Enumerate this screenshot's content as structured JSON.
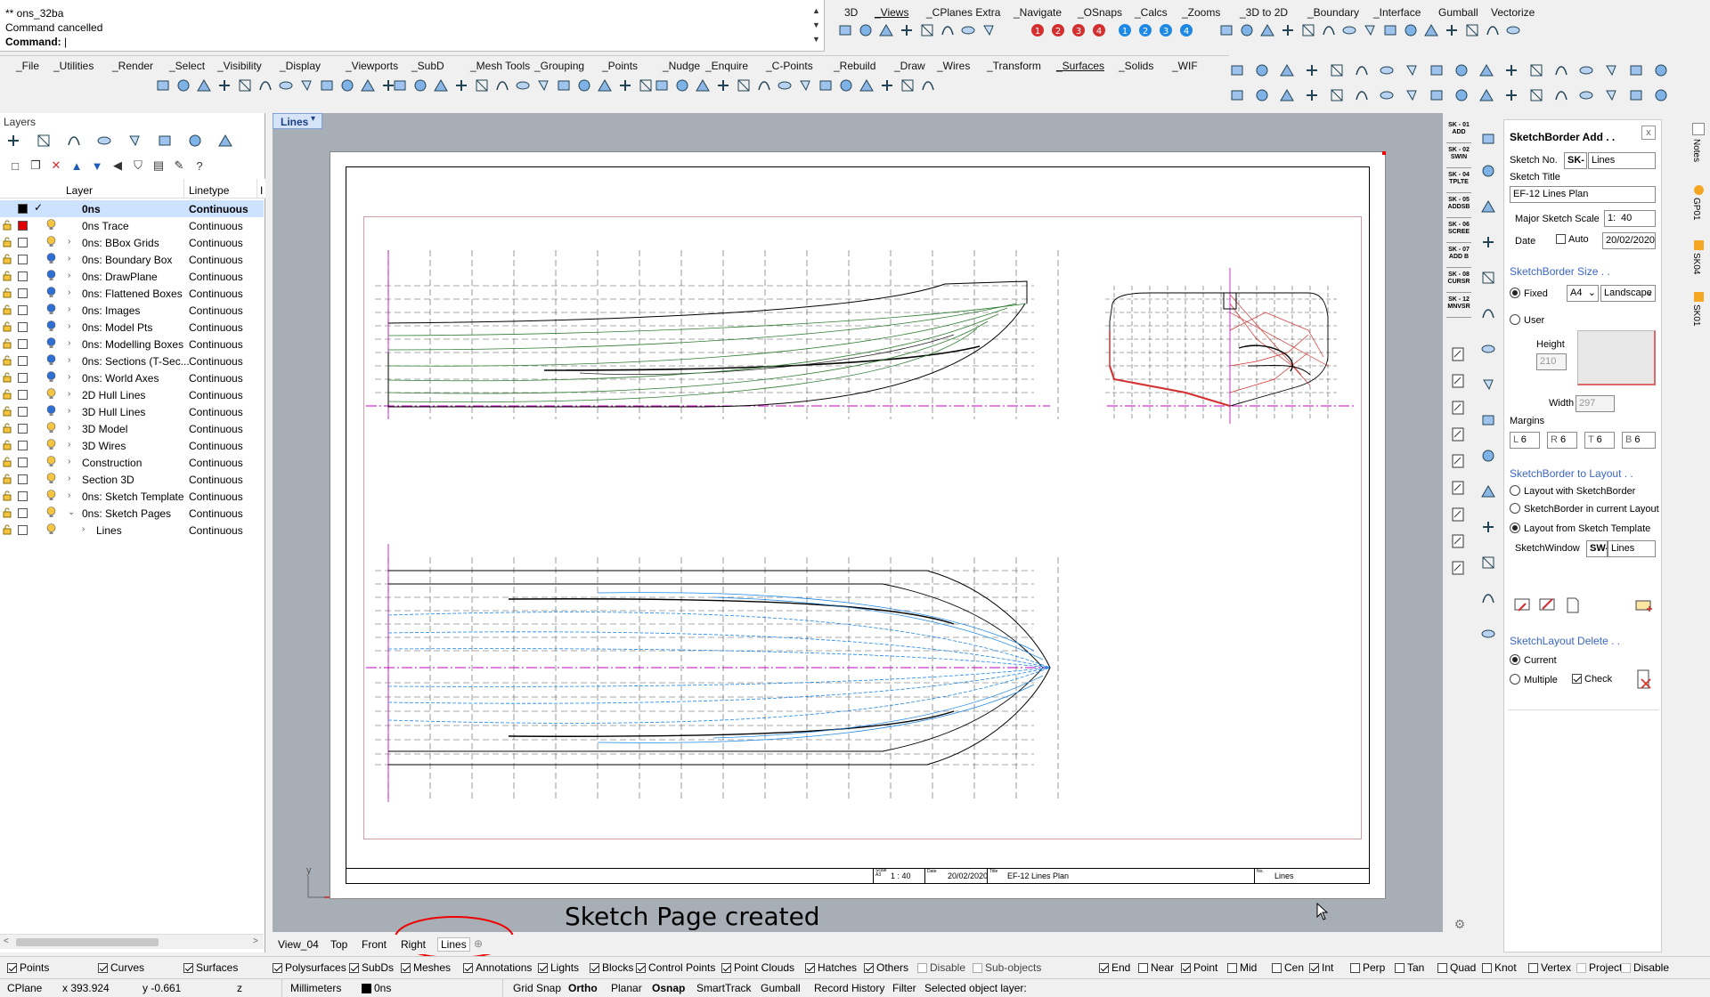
{
  "command": {
    "lines": [
      "** ons_32ba",
      "Command cancelled"
    ],
    "prompt": "Command:"
  },
  "toptabs": [
    "3D",
    "_Views",
    "_CPlanes Extra",
    "_Navigate",
    "_OSnaps",
    "_Calcs",
    "_Zooms",
    "_3D to 2D",
    "_Boundary",
    "_Interface",
    "Gumball",
    "Vectorize"
  ],
  "maintabs": [
    "_File",
    "_Utilities",
    "_Render",
    "_Select",
    "_Visibility",
    "_Display",
    "_Viewports",
    "_SubD",
    "_Mesh Tools",
    "_Grouping",
    "_Points",
    "_Nudge",
    "_Enquire",
    "_C-Points",
    "_Rebuild",
    "_Draw",
    "_Wires",
    "_Transform",
    "_Surfaces",
    "_Solids",
    "_WIF"
  ],
  "layers": {
    "title": "Layers",
    "col_layer": "Layer",
    "col_linetype": "Linetype",
    "col_extra": "I",
    "rows": [
      {
        "name": "0ns",
        "linetype": "Continuous",
        "current": true,
        "color": "#000000"
      },
      {
        "name": "0ns Trace",
        "linetype": "Continuous",
        "color": "#e00000"
      },
      {
        "name": "0ns: BBox Grids",
        "linetype": "Continuous",
        "expand": true
      },
      {
        "name": "0ns: Boundary Box",
        "linetype": "Continuous",
        "expand": true
      },
      {
        "name": "0ns: DrawPlane",
        "linetype": "Continuous",
        "expand": true
      },
      {
        "name": "0ns: Flattened Boxes",
        "linetype": "Continuous",
        "expand": true
      },
      {
        "name": "0ns: Images",
        "linetype": "Continuous",
        "expand": true
      },
      {
        "name": "0ns: Model Pts",
        "linetype": "Continuous",
        "expand": true
      },
      {
        "name": "0ns: Modelling Boxes",
        "linetype": "Continuous",
        "expand": true
      },
      {
        "name": "0ns: Sections (T-Sec...",
        "linetype": "Continuous",
        "expand": true
      },
      {
        "name": "0ns: World Axes",
        "linetype": "Continuous",
        "expand": true
      },
      {
        "name": "2D Hull Lines",
        "linetype": "Continuous",
        "expand": true
      },
      {
        "name": "3D Hull Lines",
        "linetype": "Continuous",
        "expand": true
      },
      {
        "name": "3D Model",
        "linetype": "Continuous",
        "expand": true
      },
      {
        "name": "3D Wires",
        "linetype": "Continuous",
        "expand": true
      },
      {
        "name": "Construction",
        "linetype": "Continuous",
        "expand": true
      },
      {
        "name": "Section 3D",
        "linetype": "Continuous",
        "expand": true
      },
      {
        "name": "0ns: Sketch Template",
        "linetype": "Continuous",
        "expand": true
      },
      {
        "name": "0ns: Sketch Pages",
        "linetype": "Continuous",
        "expanded": true
      },
      {
        "name": "Lines",
        "linetype": "Continuous",
        "child": true
      }
    ]
  },
  "viewport": {
    "title": "Lines",
    "tabs": [
      "View_04",
      "Top",
      "Front",
      "Right",
      "Lines"
    ],
    "annotation": "Sketch Page created",
    "axis_label": "y"
  },
  "titleblock": {
    "scale_label": "Scale A3",
    "scale": "1 : 40",
    "date_label": "Date",
    "date": "20/02/2020",
    "title_label": "Title",
    "title": "EF-12 Lines Plan",
    "no_label": "No.",
    "no": "Lines"
  },
  "sketch_tools": [
    "SK - 01 ADD",
    "SK - 02 SWIN",
    "SK - 04 TPLTE",
    "SK - 05 ADDSB",
    "SK - 06 SCREE",
    "SK - 07 ADD B",
    "SK - 08 CURSR",
    "SK - 12 MNVSR"
  ],
  "panel": {
    "title": "SketchBorder Add . .",
    "sketch_no_label": "Sketch No.",
    "sketch_no_prefix": "SK-",
    "sketch_no": "Lines",
    "sketch_title_label": "Sketch Title",
    "sketch_title": "EF-12 Lines Plan",
    "major_scale_label": "Major Sketch Scale",
    "scale_prefix": "1:",
    "scale": "40",
    "date_label": "Date",
    "auto_label": "Auto",
    "date": "20/02/2020",
    "size_header": "SketchBorder Size . .",
    "fixed_label": "Fixed",
    "paper": "A4",
    "orientation": "Landscape",
    "user_label": "User",
    "height_label": "Height",
    "height": "210",
    "width_label": "Width",
    "width": "297",
    "margins_label": "Margins",
    "m_l_label": "L",
    "m_l": "6",
    "m_r_label": "R",
    "m_r": "6",
    "m_t_label": "T",
    "m_t": "6",
    "m_b_label": "B",
    "m_b": "6",
    "layout_header": "SketchBorder to Layout . .",
    "opt1": "Layout with SketchBorder",
    "opt2": "SketchBorder in current Layout",
    "opt3": "Layout from Sketch Template",
    "window_label": "SketchWindow",
    "window_prefix": "SW-",
    "window": "Lines",
    "delete_header": "SketchLayout Delete . .",
    "current_label": "Current",
    "multiple_label": "Multiple",
    "check_label": "Check"
  },
  "side_tabs": [
    "Notes",
    "GP01",
    "SK04",
    "SK01"
  ],
  "filters": [
    "Points",
    "Curves",
    "Surfaces",
    "Polysurfaces",
    "SubDs",
    "Meshes",
    "Annotations",
    "Lights",
    "Blocks",
    "Control Points",
    "Point Clouds",
    "Hatches",
    "Others",
    "Disable",
    "Sub-objects"
  ],
  "osnaps": [
    "End",
    "Near",
    "Point",
    "Mid",
    "Cen",
    "Int",
    "Perp",
    "Tan",
    "Quad",
    "Knot",
    "Vertex",
    "Project",
    "Disable"
  ],
  "status": {
    "cplane": "CPlane",
    "x": "x 393.924",
    "y": "y -0.661",
    "z": "z",
    "units": "Millimeters",
    "layer": "0ns",
    "toggles": [
      "Grid Snap",
      "Ortho",
      "Planar",
      "Osnap",
      "SmartTrack",
      "Gumball",
      "Record History",
      "Filter"
    ],
    "message": "Selected object layer:"
  },
  "colors": {
    "accent_blue": "#2a5db0",
    "highlight": "#cde2ff",
    "viewport_bg": "#a8aeb6",
    "hull_green": "#2e7d32",
    "hull_blue": "#1e88e5",
    "hull_red": "#d32f2f",
    "grid_magenta": "#c000c0"
  }
}
